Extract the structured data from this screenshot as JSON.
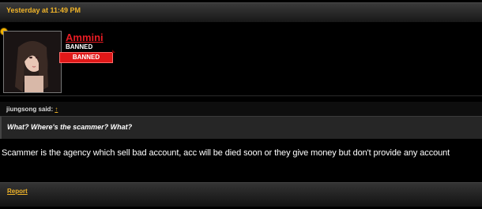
{
  "post": {
    "date": "Yesterday at 11:49 PM"
  },
  "user": {
    "name": "Ammini",
    "title": "BANNED",
    "banner": "BANNED"
  },
  "quote": {
    "author": "jiungsong said:",
    "arrow": "↑",
    "text": "What? Where's the scammer? What?"
  },
  "message": {
    "body": "Scammer is the agency which sell bad account, acc will be died soon or they give money but don't provide any account"
  },
  "footer": {
    "report_label": "Report"
  },
  "colors": {
    "accent": "#f0b429",
    "username": "#e81c24",
    "banned_ribbon": "#e01818"
  }
}
